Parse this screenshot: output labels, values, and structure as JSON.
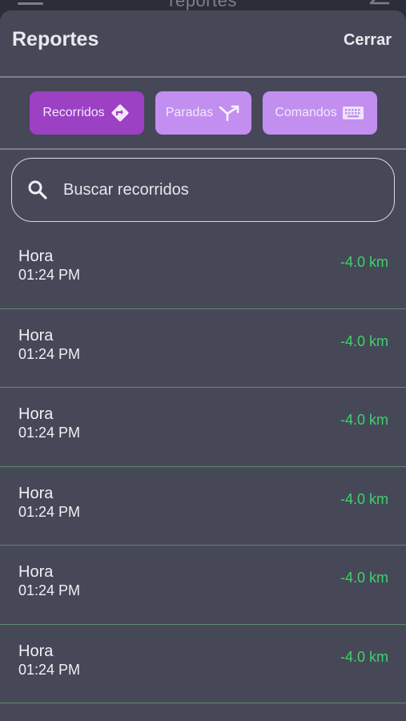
{
  "background_app": {
    "title": "reportes"
  },
  "sheet": {
    "title": "Reportes",
    "close_label": "Cerrar"
  },
  "tabs": [
    {
      "label": "Recorridos",
      "icon": "directions-icon",
      "active": true
    },
    {
      "label": "Paradas",
      "icon": "merge-icon",
      "active": false
    },
    {
      "label": "Comandos",
      "icon": "keyboard-icon",
      "active": false
    }
  ],
  "search": {
    "placeholder": "Buscar recorridos",
    "icon": "search-icon"
  },
  "trips": [
    {
      "label": "Hora",
      "time": "01:24 PM",
      "distance": "-4.0 km"
    },
    {
      "label": "Hora",
      "time": "01:24 PM",
      "distance": "-4.0 km"
    },
    {
      "label": "Hora",
      "time": "01:24 PM",
      "distance": "-4.0 km"
    },
    {
      "label": "Hora",
      "time": "01:24 PM",
      "distance": "-4.0 km"
    },
    {
      "label": "Hora",
      "time": "01:24 PM",
      "distance": "-4.0 km"
    },
    {
      "label": "Hora",
      "time": "01:24 PM",
      "distance": "-4.0 km"
    }
  ],
  "colors": {
    "sheet_bg": "#464858",
    "active_tab": "#9c40c4",
    "inactive_tab": "#c28ff0",
    "distance_text": "#3fd16a"
  }
}
